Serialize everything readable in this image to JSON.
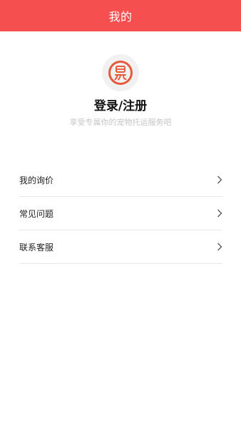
{
  "header": {
    "title": "我的"
  },
  "profile": {
    "avatar_icon": "logo-icon",
    "login_text": "登录/注册",
    "subtitle": "享受专属你的宠物托运服务吧"
  },
  "menu": {
    "items": [
      {
        "label": "我的询价",
        "icon": "chevron-right-icon"
      },
      {
        "label": "常见问题",
        "icon": "chevron-right-icon"
      },
      {
        "label": "联系客服",
        "icon": "chevron-right-icon"
      }
    ]
  },
  "colors": {
    "header_bg": "#f64f4f",
    "logo_ring": "#e65a3c",
    "subtitle": "#c6c6c6",
    "divider": "#e6e6e6"
  }
}
